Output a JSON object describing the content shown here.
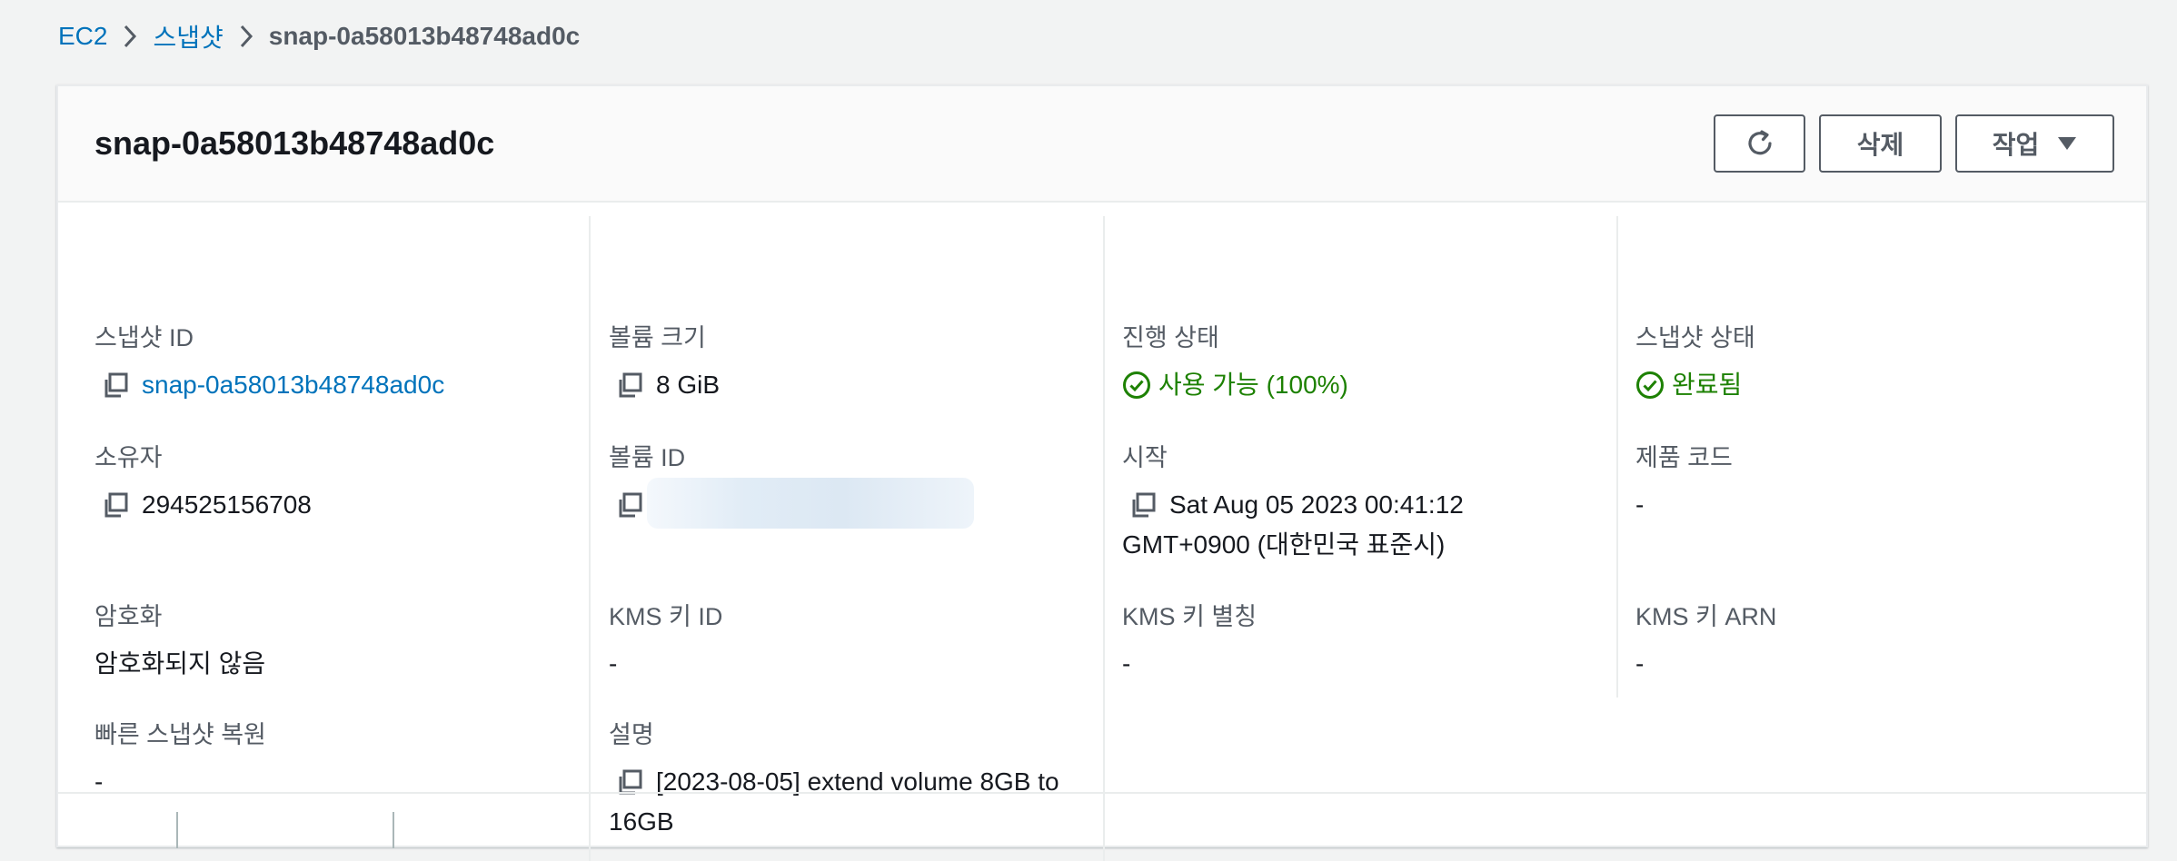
{
  "breadcrumb": {
    "items": [
      "EC2",
      "스냅샷"
    ],
    "current": "snap-0a58013b48748ad0c"
  },
  "panel": {
    "title": "snap-0a58013b48748ad0c",
    "buttons": {
      "refresh_icon": "refresh-icon",
      "delete_label": "삭제",
      "actions_label": "작업"
    }
  },
  "fields": {
    "snapshot_id": {
      "label": "스냅샷 ID",
      "value": "snap-0a58013b48748ad0c"
    },
    "owner": {
      "label": "소유자",
      "value": "294525156708"
    },
    "encryption": {
      "label": "암호화",
      "value": "암호화되지 않음"
    },
    "fast_restore": {
      "label": "빠른 스냅샷 복원",
      "value": "-"
    },
    "volume_size": {
      "label": "볼륨 크기",
      "value": "8 GiB"
    },
    "volume_id": {
      "label": "볼륨 ID",
      "value": ""
    },
    "kms_key_id": {
      "label": "KMS 키 ID",
      "value": "-"
    },
    "description": {
      "label": "설명",
      "value": "[2023-08-05] extend volume 8GB to 16GB"
    },
    "progress": {
      "label": "진행 상태",
      "value": "사용 가능 (100%)"
    },
    "started": {
      "label": "시작",
      "value": "Sat Aug 05 2023 00:41:12 GMT+0900 (대한민국 표준시)"
    },
    "kms_key_alias": {
      "label": "KMS 키 별칭",
      "value": "-"
    },
    "snapshot_state": {
      "label": "스냅샷 상태",
      "value": "완료됨"
    },
    "product_code": {
      "label": "제품 코드",
      "value": "-"
    },
    "kms_key_arn": {
      "label": "KMS 키 ARN",
      "value": "-"
    }
  },
  "colors": {
    "link": "#0073bb",
    "success": "#1d8102",
    "label": "#545b64",
    "text": "#16191f",
    "background": "#f2f3f3"
  }
}
